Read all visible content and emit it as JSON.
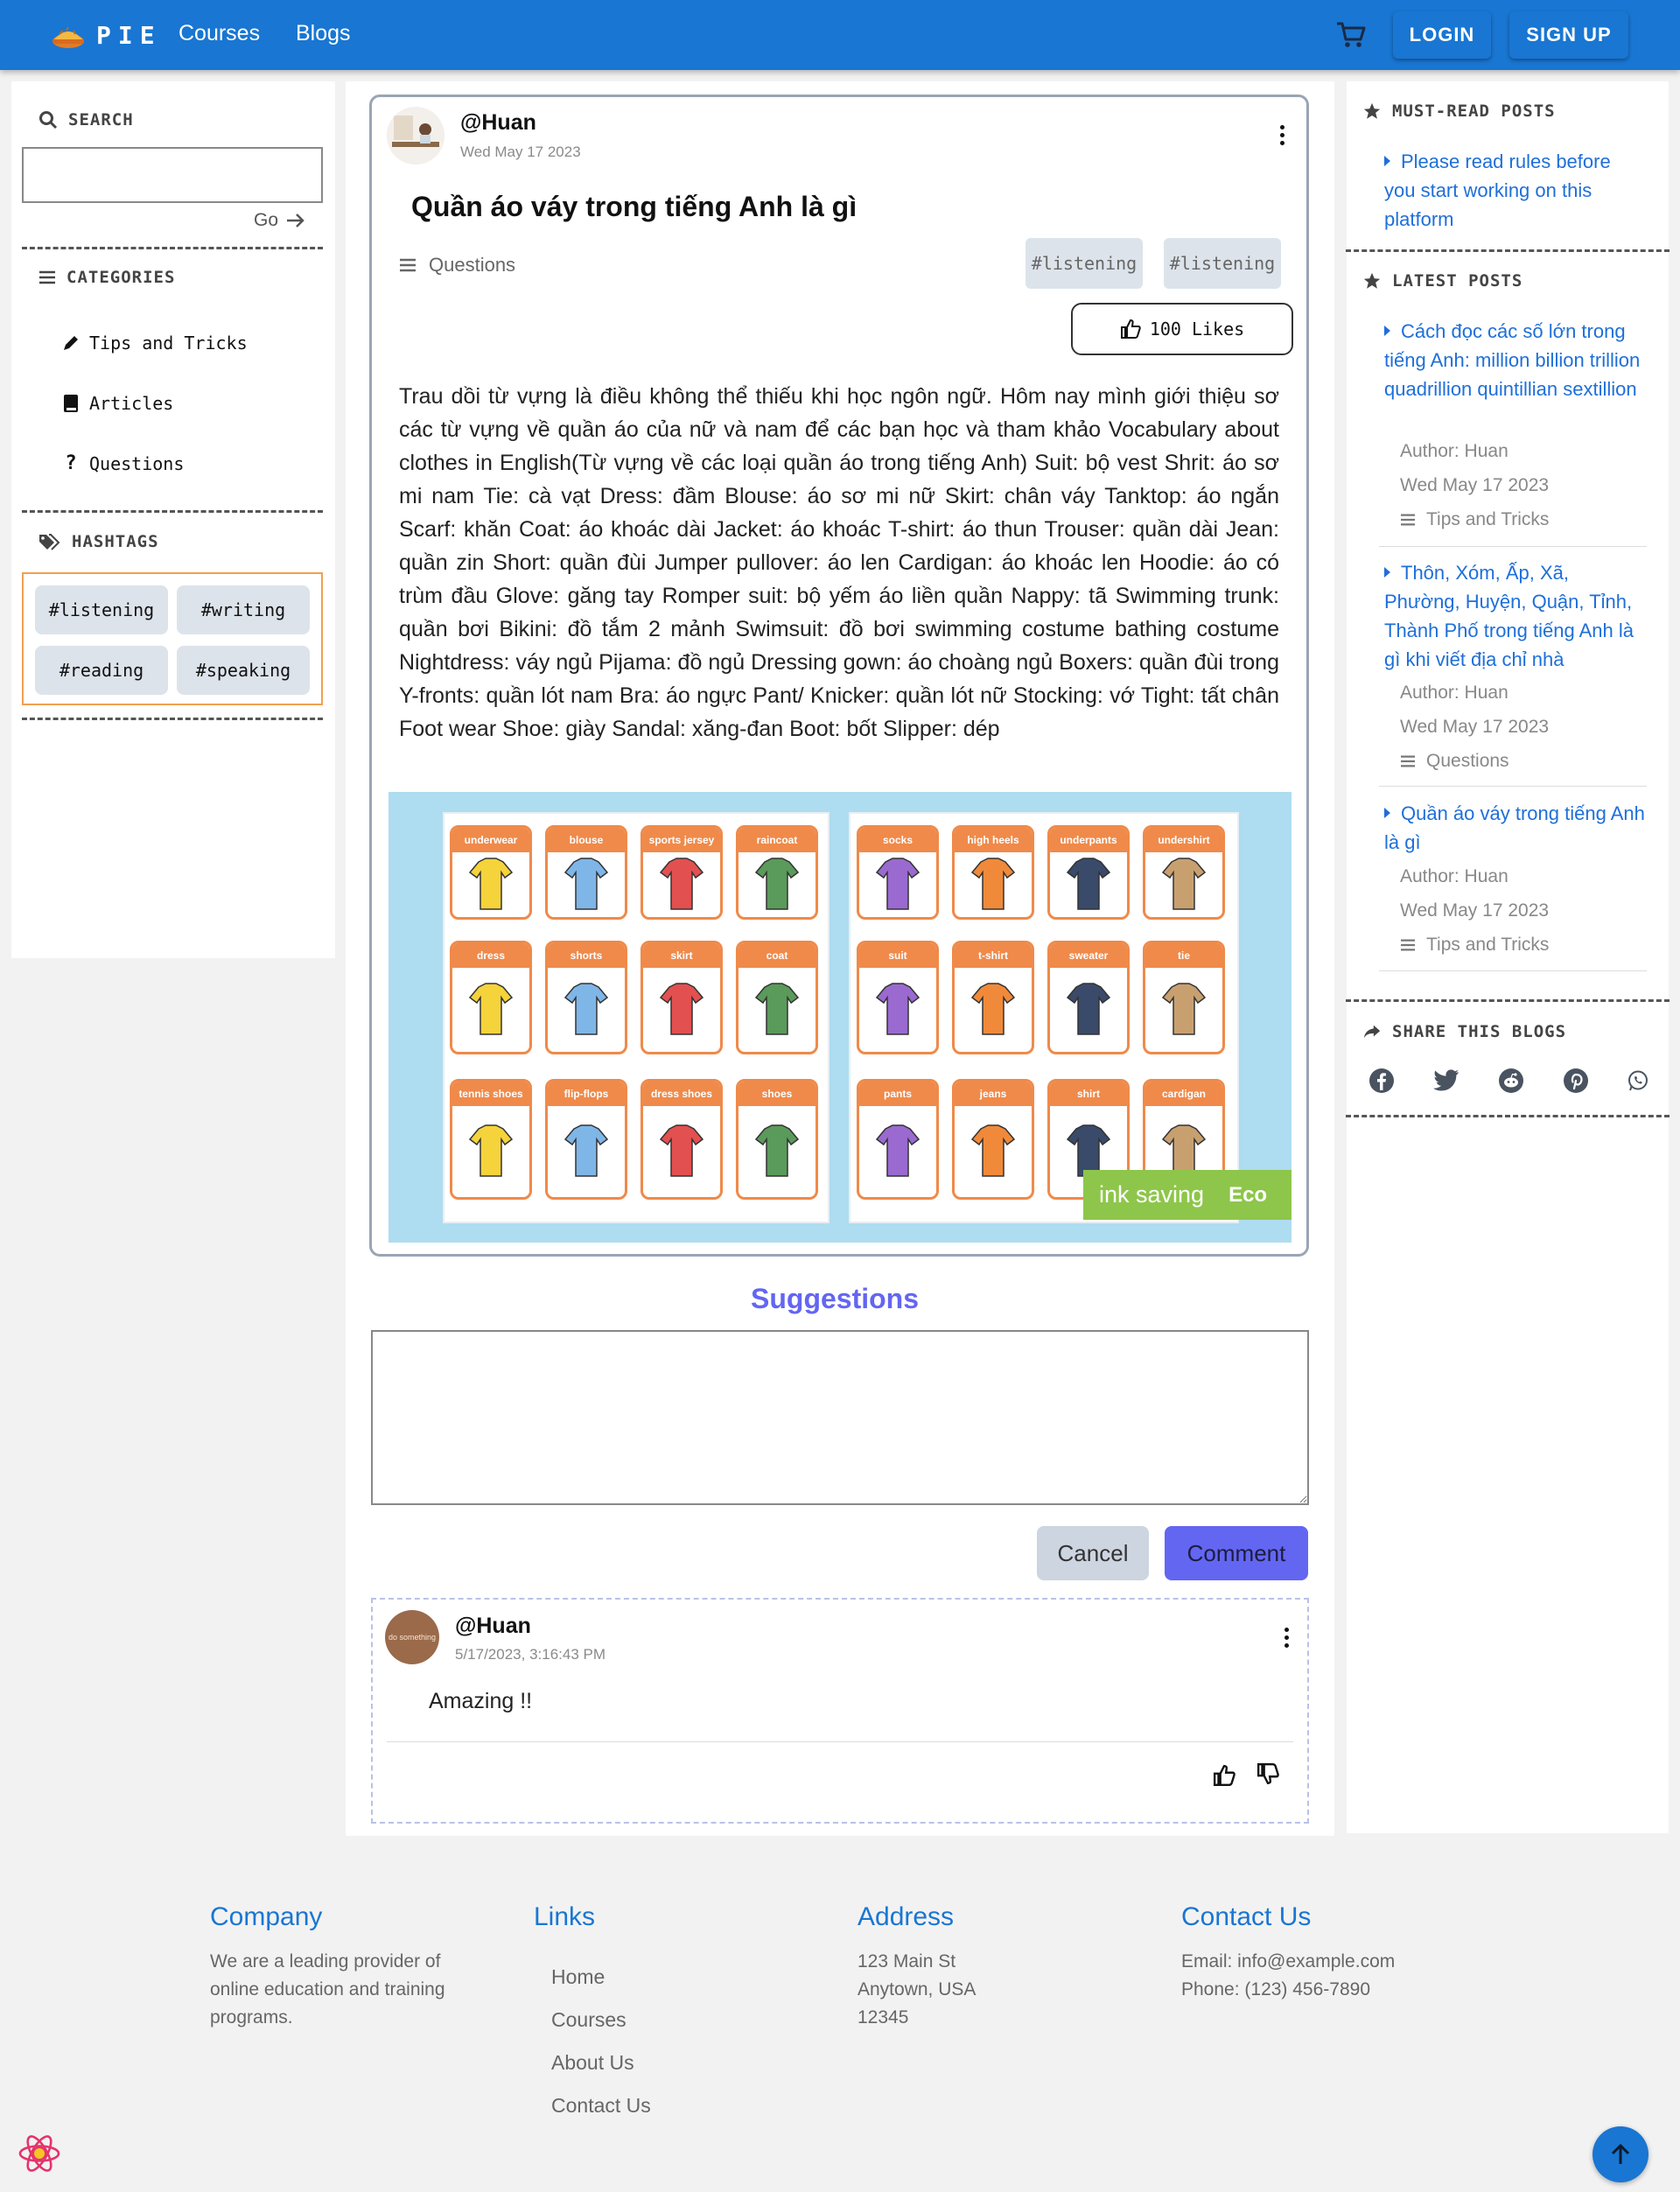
{
  "header": {
    "brand": "PIE",
    "nav": [
      "Courses",
      "Blogs"
    ],
    "login_label": "LOGIN",
    "signup_label": "SIGN UP"
  },
  "left_sidebar": {
    "search_title": "SEARCH",
    "search_value": "",
    "go_label": "Go",
    "categories_title": "CATEGORIES",
    "categories": [
      {
        "label": "Tips and Tricks",
        "icon": "pencil-icon"
      },
      {
        "label": "Articles",
        "icon": "book-icon"
      },
      {
        "label": "Questions",
        "icon": "question-icon"
      }
    ],
    "hashtags_title": "HASHTAGS",
    "hashtags": [
      "#listening",
      "#writing",
      "#reading",
      "#speaking"
    ]
  },
  "post": {
    "author": "@Huan",
    "date": "Wed May 17 2023",
    "title": "Quần áo váy trong tiếng Anh là gì",
    "category": "Questions",
    "tags": [
      "#listening",
      "#listening"
    ],
    "likes_label": "100 Likes",
    "body": "Trau dồi từ vựng là điều không thể thiếu khi học ngôn ngữ. Hôm nay mình giới thiệu sơ các từ vựng về quần áo của nữ và nam để các bạn học và tham khảo Vocabulary about clothes in English(Từ vựng về các loại quần áo trong tiếng Anh) Suit: bộ vest Shrit: áo sơ mi nam Tie: cà vạt Dress: đầm Blouse: áo sơ mi nữ Skirt: chân váy Tanktop: áo ngắn Scarf: khăn Coat: áo khoác dài Jacket: áo khoác T-shirt: áo thun Trouser: quần dài Jean: quần zin Short: quần đùi Jumper pullover: áo len Cardigan: áo khoác len Hoodie: áo có trùm đầu Glove: găng tay Romper suit: bộ yếm áo liền quần Nappy: tã Swimming trunk: quần bơi Bikini: đồ tắm 2 mảnh Swimsuit: đồ bơi swimming costume bathing costume Nightdress: váy ngủ Pijama: đồ ngủ Dressing gown: áo choàng ngủ Boxers: quần đùi trong Y-fronts: quần lót nam Bra: áo ngực Pant/ Knicker: quần lót nữ Stocking: vớ Tight: tất chân Foot wear Shoe: giày Sandal: xăng-đan Boot: bốt Slipper: dép",
    "image": {
      "cards": [
        "underwear",
        "blouse",
        "sports jersey",
        "raincoat",
        "socks",
        "high heels",
        "underpants",
        "undershirt",
        "dress",
        "shorts",
        "skirt",
        "coat",
        "suit",
        "t-shirt",
        "sweater",
        "tie",
        "tennis shoes",
        "flip-flops",
        "dress shoes",
        "shoes",
        "pants",
        "jeans",
        "shirt",
        "cardigan"
      ],
      "watermark": "ink saving",
      "watermark_badge": "Eco"
    }
  },
  "suggestions": {
    "title": "Suggestions",
    "comment_value": "",
    "cancel_label": "Cancel",
    "comment_label": "Comment"
  },
  "comment": {
    "author": "@Huan",
    "avatar_text": "do something",
    "timestamp": "5/17/2023, 3:16:43 PM",
    "text": "Amazing !!"
  },
  "right_sidebar": {
    "must_read_title": "MUST-READ POSTS",
    "must_read": [
      "Please read rules before you start working on this platform"
    ],
    "latest_title": "LATEST POSTS",
    "latest": [
      {
        "title": "Cách đọc các số lớn trong tiếng Anh: million billion trillion quadrillion quintillian sextillion",
        "author": "Author: Huan",
        "date": "Wed May 17 2023",
        "category": "Tips and Tricks"
      },
      {
        "title": "Thôn, Xóm, Ấp, Xã, Phường, Huyện, Quận, Tỉnh, Thành Phố trong tiếng Anh là gì khi viết địa chỉ nhà",
        "author": "Author: Huan",
        "date": "Wed May 17 2023",
        "category": "Questions"
      },
      {
        "title": "Quần áo váy trong tiếng Anh là gì",
        "author": "Author: Huan",
        "date": "Wed May 17 2023",
        "category": "Tips and Tricks"
      }
    ],
    "share_title": "SHARE THIS BLOGS",
    "share_icons": [
      "facebook-icon",
      "twitter-icon",
      "reddit-icon",
      "pinterest-icon",
      "whatsapp-icon"
    ]
  },
  "footer": {
    "company_title": "Company",
    "company_text": [
      "We are a leading provider of",
      "online education and training",
      "programs."
    ],
    "links_title": "Links",
    "links": [
      "Home",
      "Courses",
      "About Us",
      "Contact Us"
    ],
    "address_title": "Address",
    "address_lines": [
      "123 Main St",
      "Anytown, USA",
      "12345"
    ],
    "contact_title": "Contact Us",
    "email": "Email: info@example.com",
    "phone": "Phone: (123) 456-7890"
  },
  "colors": {
    "primary": "#1976d2",
    "accent": "#6366f1",
    "link": "#1e6fd9",
    "card_orange": "#ef8a4a"
  }
}
